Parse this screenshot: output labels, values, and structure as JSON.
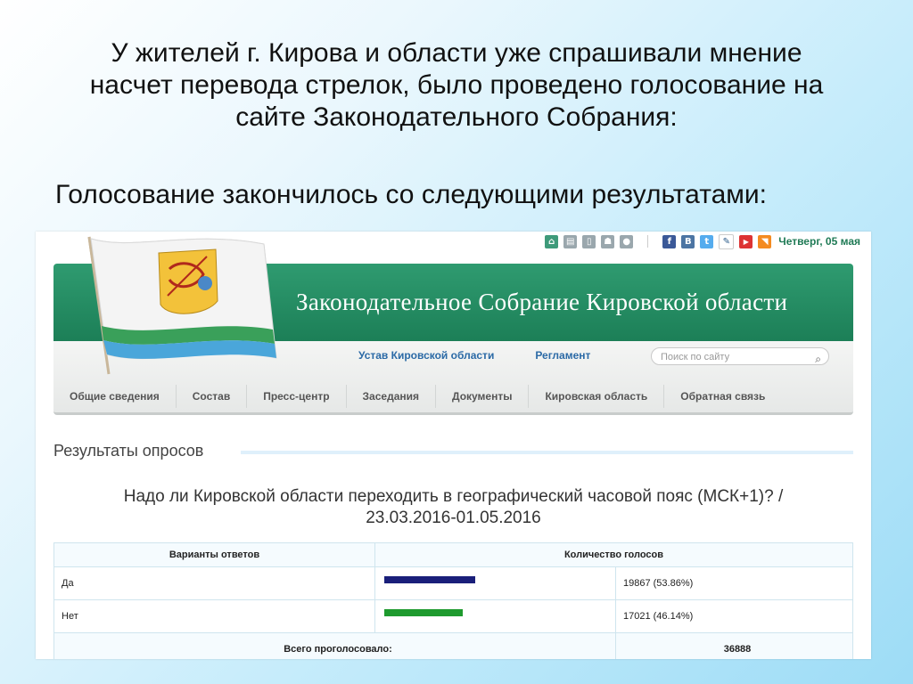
{
  "slide": {
    "title_line1": "У жителей г. Кирова и области уже спрашивали мнение",
    "title_line2": "насчет перевода стрелок, было проведено голосование на",
    "title_line3": "сайте Законодательного Собрания:",
    "subtitle": "Голосование закончилось со следующими результатами:"
  },
  "site": {
    "toolbar": {
      "icons": [
        "home-icon",
        "print-icon",
        "mobile-icon",
        "android-icon",
        "apple-icon",
        "facebook-icon",
        "vkontakte-icon",
        "twitter-icon",
        "livejournal-icon",
        "youtube-icon",
        "rss-icon"
      ],
      "date": "Четверг, 05 мая"
    },
    "banner_title": "Законодательное Собрание Кировской области",
    "links": [
      "Устав Кировской области",
      "Регламент"
    ],
    "search_placeholder": "Поиск по сайту",
    "menu": [
      "Общие сведения",
      "Состав",
      "Пресс-центр",
      "Заседания",
      "Документы",
      "Кировская область",
      "Обратная связь"
    ],
    "colors": {
      "banner": "#1f8a5c",
      "link": "#2b6aa6",
      "bar_yes": "#1a1f7a",
      "bar_no": "#1e9a2e"
    }
  },
  "poll": {
    "section_title": "Результаты опросов",
    "question_line1": "Надо ли Кировской области переходить в географический часовой пояс (МСК+1)? /",
    "question_line2": "23.03.2016-01.05.2016",
    "col_answers": "Варианты ответов",
    "col_votes": "Количество голосов",
    "rows": [
      {
        "answer": "Да",
        "votes_text": "19867 (53.86%)",
        "share": 0.5386
      },
      {
        "answer": "Нет",
        "votes_text": "17021 (46.14%)",
        "share": 0.4614
      }
    ],
    "total_label": "Всего проголосовало:",
    "total_value": "36888"
  }
}
